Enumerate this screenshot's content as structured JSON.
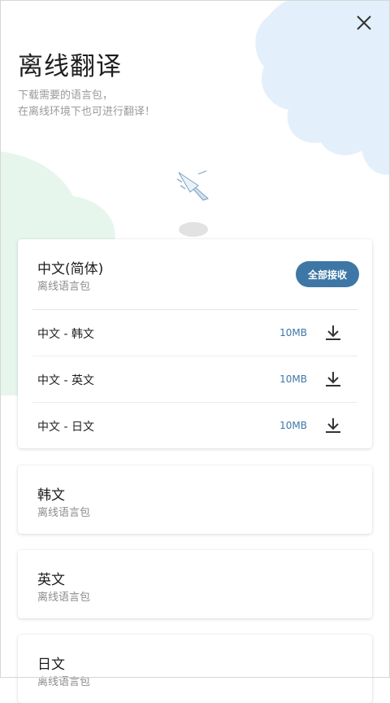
{
  "header": {
    "title": "离线翻译",
    "subtitle_lines": [
      "下载需要的语言包，",
      "在离线环境下也可进行翻译！"
    ]
  },
  "icons": {
    "close": "close-icon",
    "download": "download-icon",
    "decoration": "paper-plane-icon"
  },
  "colors": {
    "accent": "#3e77a6",
    "blob_blue": "#e3f0fb",
    "blob_green": "#e6f6ec"
  },
  "cards": [
    {
      "title": "中文(简体)",
      "subtitle": "离线语言包",
      "action_label": "全部接收",
      "packs": [
        {
          "name": "中文 - 韩文",
          "size": "10MB"
        },
        {
          "name": "中文 - 英文",
          "size": "10MB"
        },
        {
          "name": "中文 - 日文",
          "size": "10MB"
        }
      ]
    },
    {
      "title": "韩文",
      "subtitle": "离线语言包"
    },
    {
      "title": "英文",
      "subtitle": "离线语言包"
    },
    {
      "title": "日文",
      "subtitle": "离线语言包"
    }
  ]
}
